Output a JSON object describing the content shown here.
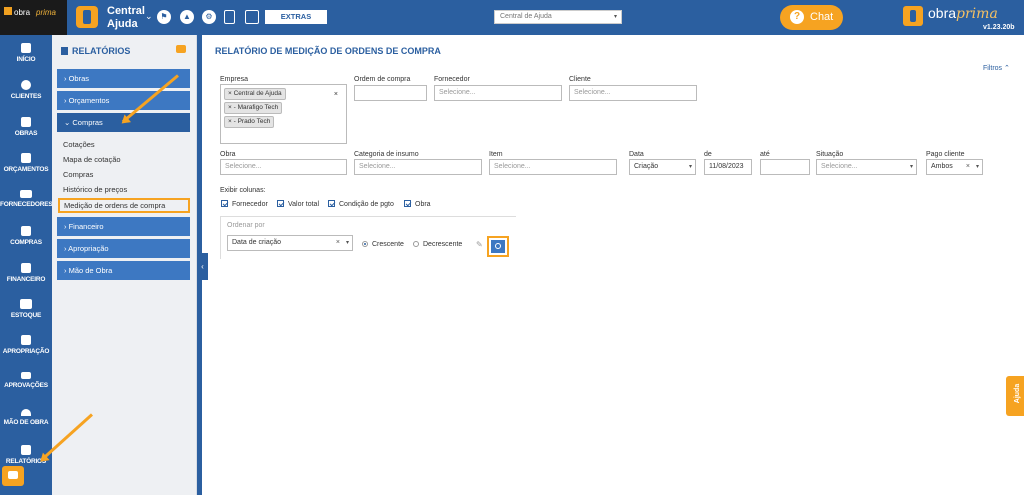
{
  "topbar": {
    "logo_text_1": "obra",
    "logo_text_2": "prima",
    "company_line1": "Central",
    "company_line2": "Ajuda",
    "extras_label": "EXTRAS",
    "company_select": "Central de Ajuda",
    "chat_label": "Chat",
    "brand_1": "obra",
    "brand_2": "prima",
    "version": "v1.23.20b"
  },
  "leftnav": [
    {
      "label": "INÍCIO",
      "icon": "home-icon"
    },
    {
      "label": "CLIENTES",
      "icon": "user-icon"
    },
    {
      "label": "OBRAS",
      "icon": "building-icon"
    },
    {
      "label": "ORÇAMENTOS",
      "icon": "document-icon"
    },
    {
      "label": "FORNECEDORES",
      "icon": "truck-icon"
    },
    {
      "label": "COMPRAS",
      "icon": "cart-icon"
    },
    {
      "label": "FINANCEIRO",
      "icon": "calculator-icon"
    },
    {
      "label": "ESTOQUE",
      "icon": "boxes-icon"
    },
    {
      "label": "APROPRIAÇÃO",
      "icon": "file-icon"
    },
    {
      "label": "APROVAÇÕES",
      "icon": "checklist-icon"
    },
    {
      "label": "MÃO DE OBRA",
      "icon": "helmet-icon"
    },
    {
      "label": "RELATÓRIOS",
      "icon": "report-icon"
    }
  ],
  "submenu": {
    "title": "RELATÓRIOS",
    "groups": {
      "obras": "› Obras",
      "orcamentos": "› Orçamentos",
      "compras": "⌄ Compras",
      "financeiro": "› Financeiro",
      "apropriacao": "› Apropriação",
      "mao_obra": "› Mão de Obra"
    },
    "links": {
      "cotacoes": "Cotações",
      "mapa": "Mapa de cotação",
      "compras": "Compras",
      "historico": "Histórico de preços",
      "medicao": "Medição de ordens de compra"
    }
  },
  "main": {
    "title": "RELATÓRIO DE MEDIÇÃO DE ORDENS DE COMPRA",
    "filters_label": "Filtros ⌃",
    "empresa": {
      "label": "Empresa",
      "tags": [
        "× Central de Ajuda",
        "× - Marafigo Tech",
        "× - Prado Tech"
      ],
      "clear": "×"
    },
    "ordem_label": "Ordem de compra",
    "fornecedor": {
      "label": "Fornecedor",
      "placeholder": "Selecione..."
    },
    "cliente": {
      "label": "Cliente",
      "placeholder": "Selecione..."
    },
    "obra": {
      "label": "Obra",
      "placeholder": "Selecione..."
    },
    "categoria": {
      "label": "Categoria de insumo",
      "placeholder": "Selecione..."
    },
    "item": {
      "label": "Item",
      "placeholder": "Selecione..."
    },
    "data": {
      "label": "Data",
      "value": "Criação"
    },
    "de": {
      "label": "de",
      "value": "11/08/2023"
    },
    "ate": {
      "label": "até"
    },
    "situacao": {
      "label": "Situação",
      "placeholder": "Selecione..."
    },
    "pago": {
      "label": "Pago cliente",
      "value": "Ambos"
    },
    "exibir_label": "Exibir colunas:",
    "columns": {
      "fornecedor": "Fornecedor",
      "valor": "Valor total",
      "condicao": "Condição de pgto",
      "obra": "Obra"
    },
    "ordenar": {
      "label": "Ordenar por",
      "value": "Data de criação",
      "asc": "Crescente",
      "desc": "Decrescente"
    }
  },
  "ajuda_tab": "Ajuda",
  "colors": {
    "primary": "#2b5fa0",
    "accent": "#f6a321"
  }
}
